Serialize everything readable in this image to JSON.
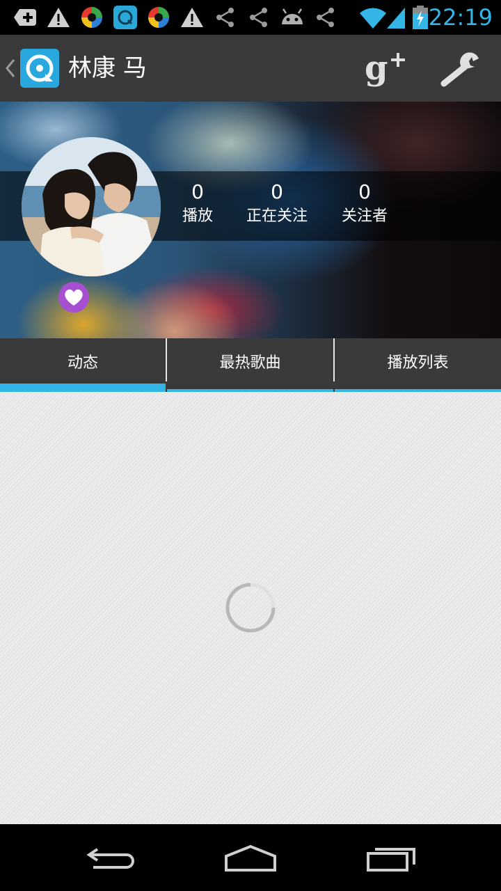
{
  "status_bar": {
    "time": "22:19",
    "accent_color": "#33b5e5",
    "notification_icons": [
      "add-box-icon",
      "warning-icon",
      "colorful-app-icon",
      "app-q-icon",
      "colorful-app-icon",
      "warning-icon",
      "share-icon",
      "share-icon",
      "android-icon",
      "share-icon"
    ],
    "system_icons": [
      "wifi-icon",
      "signal-icon",
      "battery-charging-icon"
    ]
  },
  "action_bar": {
    "title": "林康 马",
    "icons": [
      "back-caret-icon",
      "app-logo-icon",
      "google-plus-icon",
      "wrench-icon"
    ]
  },
  "profile": {
    "stats": [
      {
        "value": "0",
        "label": "播放"
      },
      {
        "value": "0",
        "label": "正在关注"
      },
      {
        "value": "0",
        "label": "关注者"
      }
    ],
    "badge_icon": "heart-icon",
    "badge_color": "#a64fd0"
  },
  "tabs": [
    {
      "label": "动态",
      "selected": true
    },
    {
      "label": "最热歌曲",
      "selected": false
    },
    {
      "label": "播放列表",
      "selected": false
    }
  ],
  "content": {
    "state_icon": "loading-spinner-icon"
  },
  "nav_bar": {
    "icons": [
      "back-nav-icon",
      "home-nav-icon",
      "recents-nav-icon"
    ]
  }
}
